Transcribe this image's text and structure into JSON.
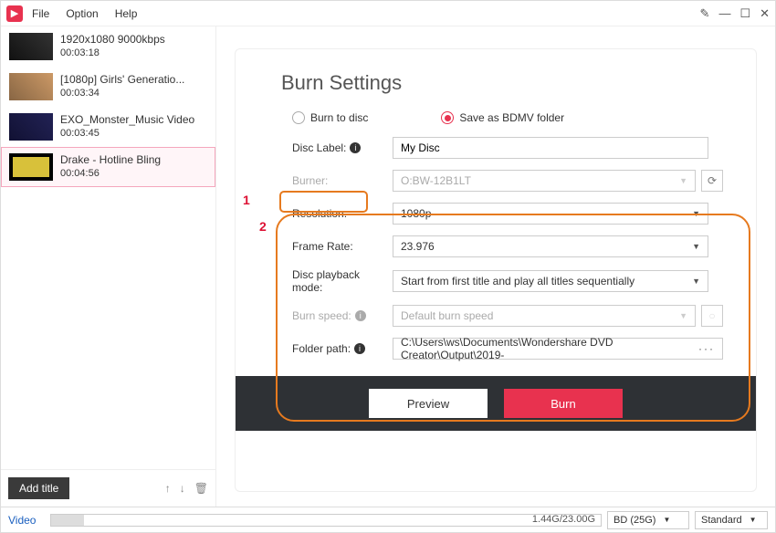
{
  "menu": {
    "file": "File",
    "option": "Option",
    "help": "Help"
  },
  "videos": [
    {
      "title": "1920x1080 9000kbps",
      "duration": "00:03:18"
    },
    {
      "title": "[1080p] Girls' Generatio...",
      "duration": "00:03:34"
    },
    {
      "title": "EXO_Monster_Music Video",
      "duration": "00:03:45"
    },
    {
      "title": "Drake - Hotline Bling",
      "duration": "00:04:56"
    }
  ],
  "sidebar": {
    "add_title": "Add title"
  },
  "panel": {
    "title": "Burn Settings",
    "radio_burn": "Burn to disc",
    "radio_bdmv": "Save as BDMV folder",
    "annot1": "1",
    "annot2": "2"
  },
  "form": {
    "disc_label_label": "Disc Label:",
    "disc_label_value": "My Disc",
    "burner_label": "Burner:",
    "burner_value": "O:BW-12B1LT",
    "resolution_label": "Resolution:",
    "resolution_value": "1080p",
    "framerate_label": "Frame Rate:",
    "framerate_value": "23.976",
    "playback_label": "Disc playback mode:",
    "playback_value": "Start from first title and play all titles sequentially",
    "burnspeed_label": "Burn speed:",
    "burnspeed_value": "Default burn speed",
    "folder_label": "Folder path:",
    "folder_value": "C:\\Users\\ws\\Documents\\Wondershare DVD Creator\\Output\\2019-"
  },
  "actions": {
    "preview": "Preview",
    "burn": "Burn"
  },
  "status": {
    "label": "Video",
    "size": "1.44G/23.00G",
    "disc_type": "BD (25G)",
    "quality": "Standard"
  }
}
